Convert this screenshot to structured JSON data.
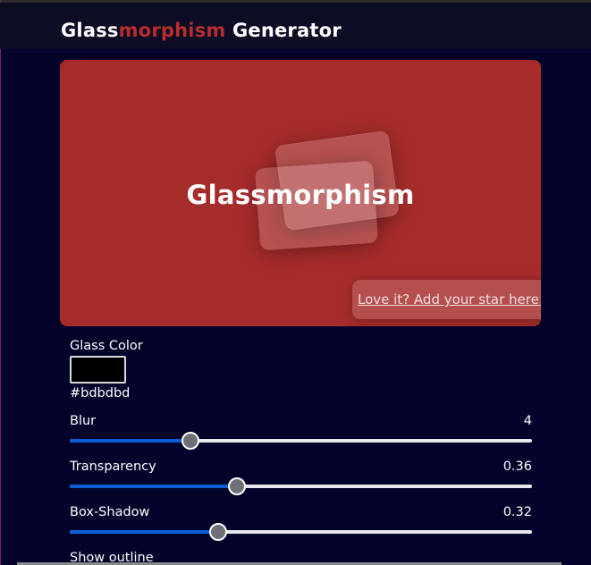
{
  "header": {
    "title_part1": "Glass",
    "title_part2": "morphism",
    "title_part3": " Generator"
  },
  "preview": {
    "background_color": "#a62c2b",
    "heading": "Glassmorphism",
    "star_link": "Love it? Add your star here!",
    "star_emoji_icon": "star-struck-emoji-icon"
  },
  "controls": {
    "glass_color": {
      "label": "Glass Color",
      "swatch_color": "#000000",
      "hex_value": "#bdbdbd"
    },
    "blur": {
      "label": "Blur",
      "value": "4",
      "fraction": 0.26
    },
    "transparency": {
      "label": "Transparency",
      "value": "0.36",
      "fraction": 0.36
    },
    "box_shadow": {
      "label": "Box-Shadow",
      "value": "0.32",
      "fraction": 0.32
    },
    "show_outline": {
      "label": "Show outline"
    }
  },
  "colors": {
    "accent": "#b82d2d",
    "slider_fill": "#0c5ed6",
    "page_background": "#02022a"
  }
}
